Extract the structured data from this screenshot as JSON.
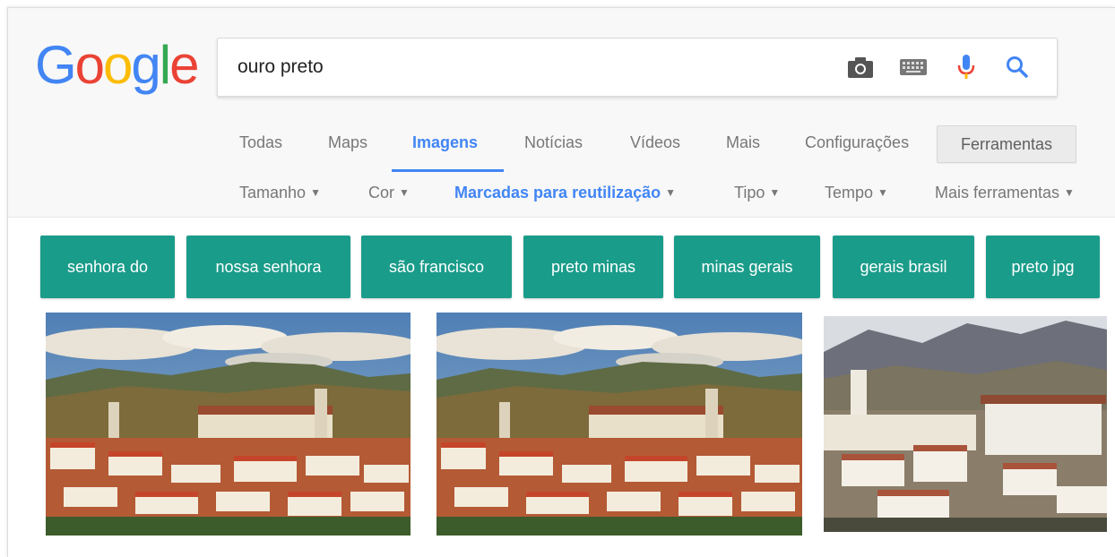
{
  "search": {
    "query": "ouro preto"
  },
  "logo": {
    "letters": [
      "G",
      "o",
      "o",
      "g",
      "l",
      "e"
    ],
    "colors": [
      "#4285f4",
      "#ea4335",
      "#fbbc05",
      "#4285f4",
      "#34a853",
      "#ea4335"
    ]
  },
  "tabs": [
    "Todas",
    "Maps",
    "Imagens",
    "Notícias",
    "Vídeos",
    "Mais",
    "Configurações"
  ],
  "tools_label": "Ferramentas",
  "filters": [
    "Tamanho",
    "Cor",
    "Marcadas para reutilização",
    "Tipo",
    "Tempo",
    "Mais ferramentas"
  ],
  "chips": [
    "senhora do",
    "nossa senhora",
    "são francisco",
    "preto minas",
    "minas gerais",
    "gerais brasil",
    "preto jpg"
  ],
  "colors": {
    "accent": "#4285f4",
    "chip": "#1a9c8a",
    "tab_text": "#777777"
  }
}
